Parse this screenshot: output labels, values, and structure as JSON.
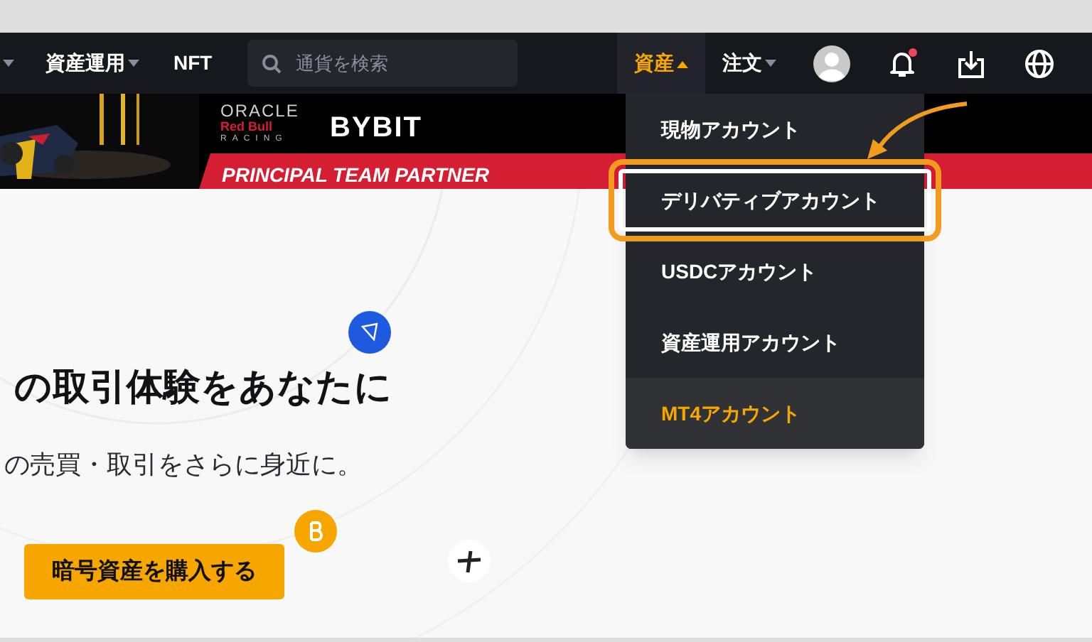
{
  "nav": {
    "left_items": [
      {
        "label": "資産運用",
        "has_menu": true
      },
      {
        "label": "NFT",
        "has_menu": false
      }
    ],
    "search": {
      "placeholder": "通貨を検索"
    },
    "right_items": [
      {
        "label": "資産",
        "open": true
      },
      {
        "label": "注文",
        "open": false
      }
    ],
    "notifications": {
      "unread": true
    }
  },
  "banner": {
    "partner_logo": [
      "ORACLE",
      "Red Bull",
      "RACING"
    ],
    "brand": "BYBIT",
    "tagline": "PRINCIPAL TEAM PARTNER"
  },
  "hero": {
    "title": "の取引体験をあなたに",
    "subtitle": "の売買・取引をさらに身近に。",
    "button": "暗号資産を購入する"
  },
  "asset_menu": [
    {
      "label": "現物アカウント",
      "hovered": false,
      "highlighted": false
    },
    {
      "label": "デリバティブアカウント",
      "hovered": false,
      "highlighted": true
    },
    {
      "label": "USDCアカウント",
      "hovered": false,
      "highlighted": false
    },
    {
      "label": "資産運用アカウント",
      "hovered": false,
      "highlighted": false
    },
    {
      "label": "MT4アカウント",
      "hovered": true,
      "highlighted": false
    }
  ]
}
